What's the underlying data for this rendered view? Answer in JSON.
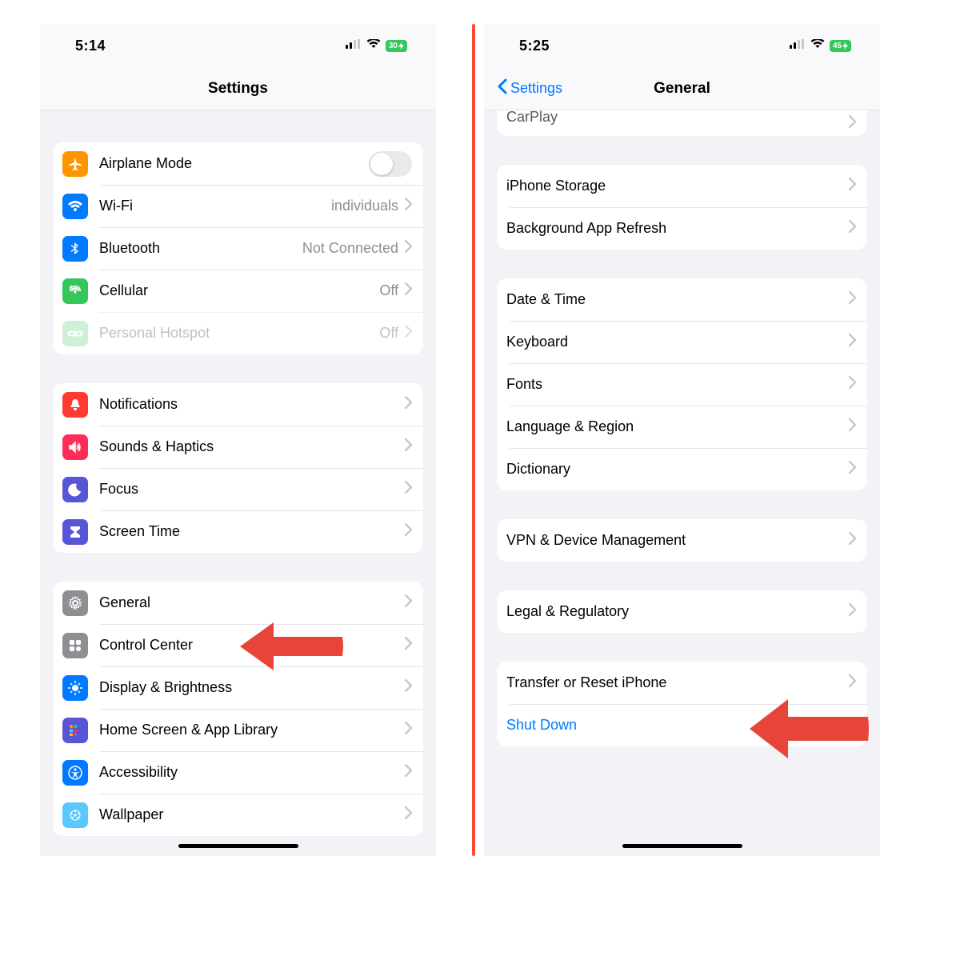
{
  "left": {
    "statusbar": {
      "time": "5:14",
      "battery": "30"
    },
    "header": {
      "title": "Settings"
    },
    "group1": {
      "airplane": {
        "label": "Airplane Mode"
      },
      "wifi": {
        "label": "Wi-Fi",
        "value": "individuals"
      },
      "bluetooth": {
        "label": "Bluetooth",
        "value": "Not Connected"
      },
      "cellular": {
        "label": "Cellular",
        "value": "Off"
      },
      "hotspot": {
        "label": "Personal Hotspot",
        "value": "Off"
      }
    },
    "group2": {
      "notifications": {
        "label": "Notifications"
      },
      "sounds": {
        "label": "Sounds & Haptics"
      },
      "focus": {
        "label": "Focus"
      },
      "screentime": {
        "label": "Screen Time"
      }
    },
    "group3": {
      "general": {
        "label": "General"
      },
      "controlcenter": {
        "label": "Control Center"
      },
      "display": {
        "label": "Display & Brightness"
      },
      "homescreen": {
        "label": "Home Screen & App Library"
      },
      "accessibility": {
        "label": "Accessibility"
      },
      "wallpaper": {
        "label": "Wallpaper"
      }
    }
  },
  "right": {
    "statusbar": {
      "time": "5:25",
      "battery": "45"
    },
    "header": {
      "title": "General",
      "back": "Settings"
    },
    "peek": {
      "carplay": "CarPlay"
    },
    "group1": {
      "storage": {
        "label": "iPhone Storage"
      },
      "refresh": {
        "label": "Background App Refresh"
      }
    },
    "group2": {
      "datetime": {
        "label": "Date & Time"
      },
      "keyboard": {
        "label": "Keyboard"
      },
      "fonts": {
        "label": "Fonts"
      },
      "language": {
        "label": "Language & Region"
      },
      "dictionary": {
        "label": "Dictionary"
      }
    },
    "group3": {
      "vpn": {
        "label": "VPN & Device Management"
      }
    },
    "group4": {
      "legal": {
        "label": "Legal & Regulatory"
      }
    },
    "group5": {
      "reset": {
        "label": "Transfer or Reset iPhone"
      },
      "shutdown": {
        "label": "Shut Down"
      }
    }
  },
  "colors": {
    "orange": "#ff9500",
    "blue": "#007aff",
    "red": "#ff3b30",
    "green": "#34c759",
    "gray": "#8e8e93",
    "purple": "#5856d6",
    "cyan": "#5ac8fa",
    "teal": "#8ad7c7",
    "arrow": "#e8453a"
  }
}
